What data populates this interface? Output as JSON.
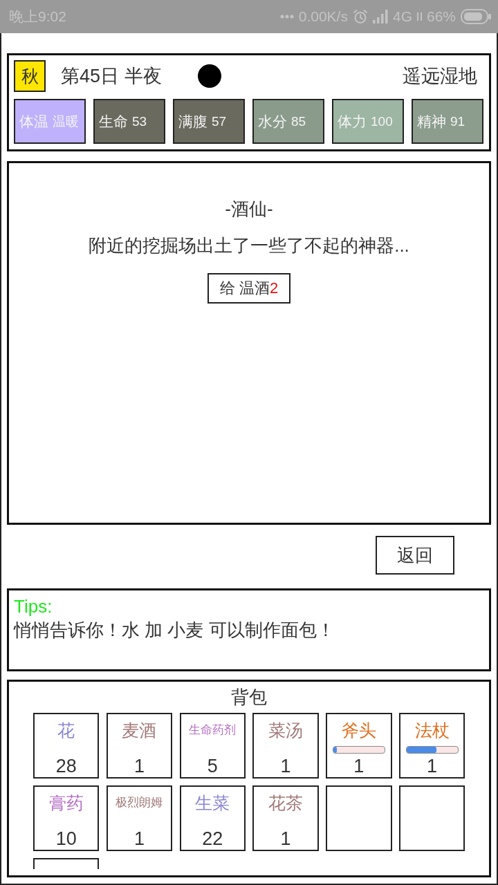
{
  "status_bar": {
    "time": "晚上9:02",
    "network_speed": "0.00K/s",
    "network_type": "4G",
    "battery": "66%"
  },
  "header": {
    "season": "秋",
    "date_time": "第45日 半夜",
    "location": "遥远湿地",
    "stats": [
      {
        "label": "体温",
        "value": "温暖",
        "color": "#bfb1fb"
      },
      {
        "label": "生命",
        "value": "53",
        "color": "#6b6a5f"
      },
      {
        "label": "满腹",
        "value": "57",
        "color": "#6b6a5f"
      },
      {
        "label": "水分",
        "value": "85",
        "color": "#8a9b8b"
      },
      {
        "label": "体力",
        "value": "100",
        "color": "#9db5a3"
      },
      {
        "label": "精神",
        "value": "91",
        "color": "#8c9d8d"
      }
    ]
  },
  "dialog": {
    "speaker": "-酒仙-",
    "message": "附近的挖掘场出土了一些了不起的神器...",
    "options": [
      {
        "label": "给 温酒",
        "count": "2"
      }
    ]
  },
  "back_button": "返回",
  "tips": {
    "title": "Tips:",
    "text": "悄悄告诉你！水 加 小麦 可以制作面包！"
  },
  "inventory": {
    "title": "背包",
    "slots": [
      {
        "kind": "item",
        "name": "花",
        "count": "28",
        "color": "#8a86d6"
      },
      {
        "kind": "item",
        "name": "麦酒",
        "count": "1",
        "color": "#a27878"
      },
      {
        "kind": "item",
        "name": "生命药剂",
        "count": "5",
        "color": "#b36fc4"
      },
      {
        "kind": "item",
        "name": "菜汤",
        "count": "1",
        "color": "#a27878"
      },
      {
        "kind": "tool",
        "name": "斧头",
        "count": "1",
        "color": "#e06c1a",
        "level": 0.07
      },
      {
        "kind": "tool",
        "name": "法杖",
        "count": "1",
        "color": "#e06c1a",
        "level": 0.59
      },
      {
        "kind": "item",
        "name": "膏药",
        "count": "10",
        "color": "#b36fc4"
      },
      {
        "kind": "item",
        "name": "极烈朗姆",
        "count": "1",
        "color": "#a27878"
      },
      {
        "kind": "item",
        "name": "生菜",
        "count": "22",
        "color": "#8a86d6"
      },
      {
        "kind": "item",
        "name": "花茶",
        "count": "1",
        "color": "#a27878"
      },
      {
        "kind": "empty"
      },
      {
        "kind": "empty"
      },
      {
        "kind": "empty"
      }
    ]
  }
}
